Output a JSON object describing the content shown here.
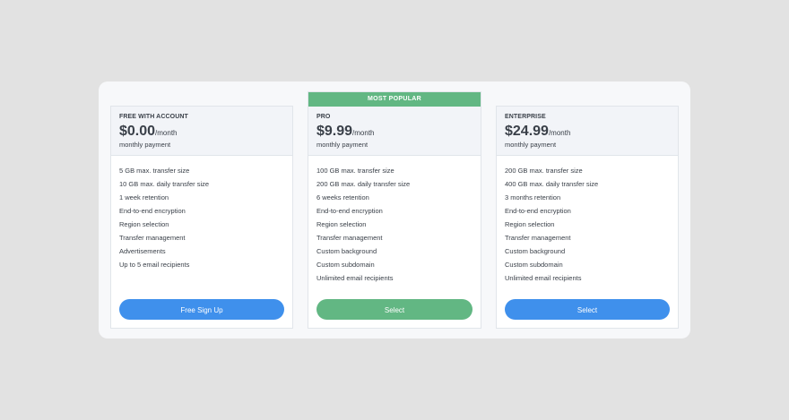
{
  "plans": [
    {
      "name": "FREE WITH ACCOUNT",
      "price": "$0.00",
      "period": "/month",
      "note": "monthly payment",
      "features": [
        "5 GB max. transfer size",
        "10 GB max. daily transfer size",
        "1 week retention",
        "End-to-end encryption",
        "Region selection",
        "Transfer management",
        "Advertisements",
        "Up to 5 email recipients"
      ],
      "button": "Free Sign Up"
    },
    {
      "badge": "MOST POPULAR",
      "name": "PRO",
      "price": "$9.99",
      "period": "/month",
      "note": "monthly payment",
      "features": [
        "100 GB max. transfer size",
        "200 GB max. daily transfer size",
        "6 weeks retention",
        "End-to-end encryption",
        "Region selection",
        "Transfer management",
        "Custom background",
        "Custom subdomain",
        "Unlimited email recipients"
      ],
      "button": "Select"
    },
    {
      "name": "ENTERPRISE",
      "price": "$24.99",
      "period": "/month",
      "note": "monthly payment",
      "features": [
        "200 GB max. transfer size",
        "400 GB max. daily transfer size",
        "3 months retention",
        "End-to-end encryption",
        "Region selection",
        "Transfer management",
        "Custom background",
        "Custom subdomain",
        "Unlimited email recipients"
      ],
      "button": "Select"
    }
  ],
  "colors": {
    "accent_blue": "#3f90ec",
    "accent_green": "#62b783",
    "text": "#3a4049",
    "header_bg": "#f2f4f8"
  }
}
